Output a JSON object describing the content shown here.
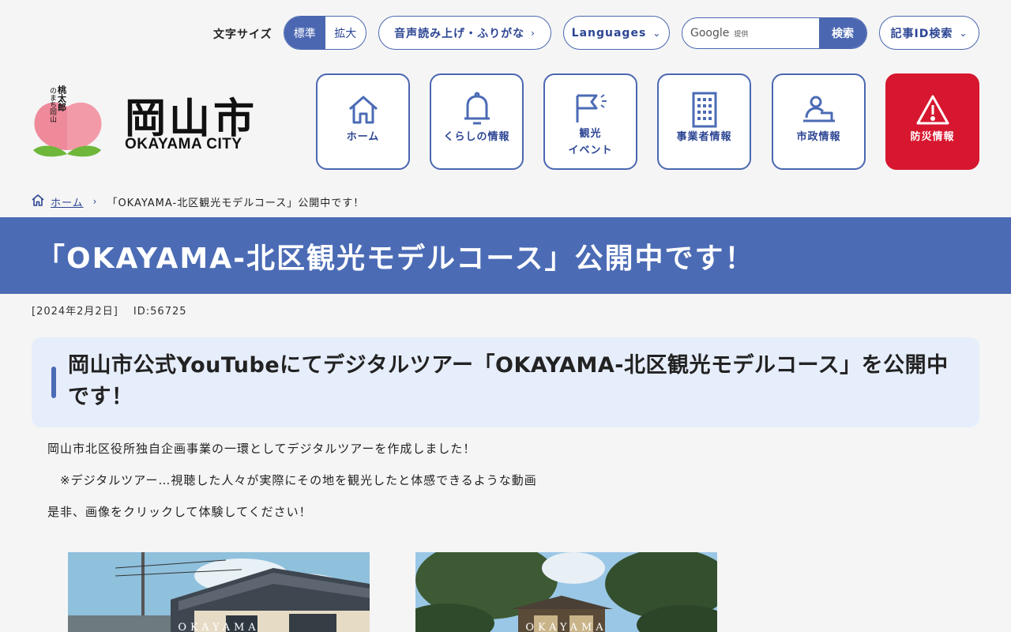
{
  "utility": {
    "font_size_label": "文字サイズ",
    "font_size_standard": "標準",
    "font_size_large": "拡大",
    "read_aloud": "音声読み上げ・ふりがな",
    "languages": "Languages",
    "search_google": "Google",
    "search_provided": "提供",
    "search_button": "検索",
    "article_id_search": "記事ID検索"
  },
  "logo": {
    "kanji": "岡山市",
    "roman": "OKAYAMA CITY",
    "mascot_side": "のまち岡山",
    "mascot_vertical": "桃太郎"
  },
  "nav": {
    "items": [
      {
        "label": "ホーム",
        "icon": "home-icon"
      },
      {
        "label": "くらしの情報",
        "icon": "bell-icon"
      },
      {
        "label": "観光\nイベント",
        "icon": "flag-icon"
      },
      {
        "label": "事業者情報",
        "icon": "building-icon"
      },
      {
        "label": "市政情報",
        "icon": "podium-icon"
      },
      {
        "label": "防災情報",
        "icon": "warning-icon"
      }
    ]
  },
  "breadcrumb": {
    "home": "ホーム",
    "current": "「OKAYAMA-北区観光モデルコース」公開中です！"
  },
  "page": {
    "title": "「OKAYAMA-北区観光モデルコース」公開中です！",
    "date": "[2024年2月2日]",
    "id": "ID:56725",
    "heading": "岡山市公式YouTubeにてデジタルツアー「OKAYAMA-北区観光モデルコース」を公開中です！",
    "paragraphs": [
      "岡山市北区役所独自企画事業の一環としてデジタルツアーを作成しました！",
      "　※デジタルツアー…視聴した人々が実際にその地を観光したと体感できるような動画",
      "是非、画像をクリックして体験してください！"
    ],
    "thumb_caption_1": "OKAYAMA",
    "thumb_caption_2": "OKAYAMA"
  },
  "colors": {
    "primary": "#4b6bb5",
    "primary_dark": "#2c4593",
    "danger": "#d7172f",
    "heading_bg": "#e7eefb"
  }
}
